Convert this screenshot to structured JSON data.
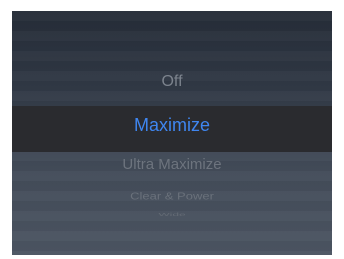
{
  "picker": {
    "items": [
      {
        "label": "Off",
        "selected": false
      },
      {
        "label": "Maximize",
        "selected": true
      },
      {
        "label": "Ultra Maximize",
        "selected": false
      },
      {
        "label": "Clear & Power",
        "selected": false
      },
      {
        "label": "Wide",
        "selected": false
      }
    ],
    "selected_color": "#3f86f0",
    "unselected_color": "#7c838d"
  }
}
